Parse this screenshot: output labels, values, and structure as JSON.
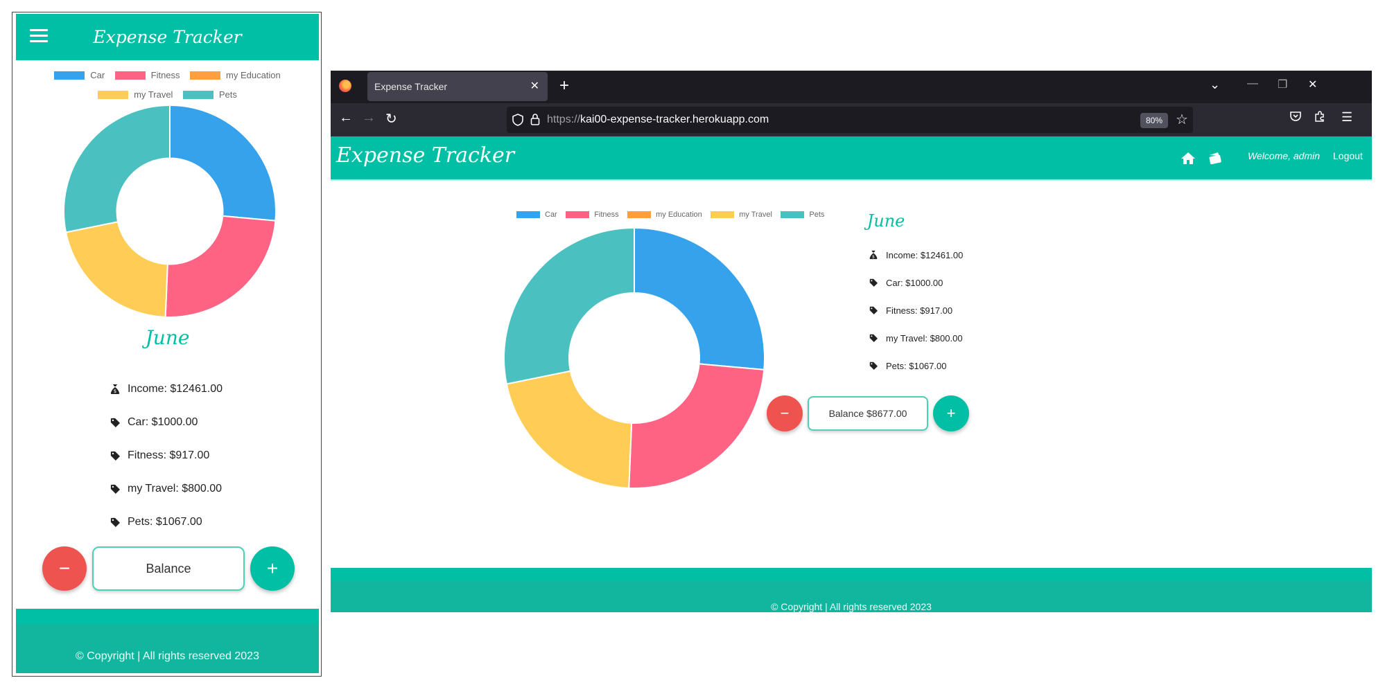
{
  "colors": {
    "brand": "#00bfa5",
    "car": "#36a2eb",
    "fitness": "#ff6384",
    "my_education": "#ff9f40",
    "my_travel": "#ffcd56",
    "pets": "#4bc0c0",
    "minus": "#ef5350"
  },
  "app": {
    "title": "Expense Tracker"
  },
  "month": "June",
  "summary": {
    "income": "Income: $12461.00",
    "car": "Car: $1000.00",
    "fitness": "Fitness: $917.00",
    "travel": "my Travel: $800.00",
    "pets": "Pets: $1067.00"
  },
  "mobile": {
    "balance_label": "Balance"
  },
  "desktop": {
    "balance_label": "Balance $8677.00"
  },
  "controls": {
    "minus_symbol": "−",
    "plus_symbol": "+"
  },
  "footer": {
    "text": "© Copyright | All rights reserved 2023"
  },
  "browser": {
    "tab_title": "Expense Tracker",
    "url_protocol": "https://",
    "url_host": "kai00-expense-tracker.herokuapp.com",
    "zoom": "80%"
  },
  "nav": {
    "welcome": "Welcome, admin",
    "logout": "Logout"
  },
  "chart_data": {
    "type": "pie",
    "hole": 0.5,
    "categories": [
      "Car",
      "Fitness",
      "my Education",
      "my Travel",
      "Pets"
    ],
    "values": [
      1000,
      917,
      0,
      800,
      1067
    ],
    "colors": [
      "#36a2eb",
      "#ff6384",
      "#ff9f40",
      "#ffcd56",
      "#4bc0c0"
    ],
    "legend": "top"
  }
}
